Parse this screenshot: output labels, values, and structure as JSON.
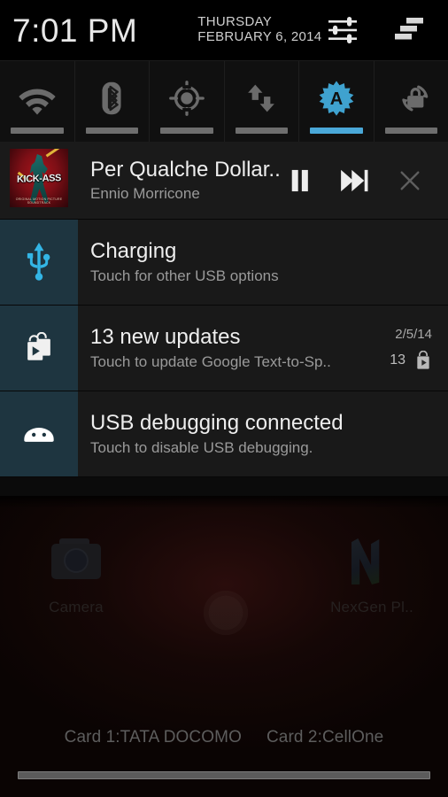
{
  "status_bar": {
    "clock": "7:01 PM",
    "weekday": "THURSDAY",
    "date": "FEBRUARY 6, 2014",
    "settings_icon": "settings-sliders-icon",
    "notification_list_icon": "notification-list-icon"
  },
  "quick_settings": {
    "toggles": [
      {
        "name": "wifi",
        "icon": "wifi-icon",
        "label": "Wi-Fi",
        "active": false
      },
      {
        "name": "bluetooth",
        "icon": "bluetooth-icon",
        "label": "Bluetooth",
        "active": false
      },
      {
        "name": "gps",
        "icon": "location-gps-icon",
        "label": "GPS",
        "active": false
      },
      {
        "name": "data-sync",
        "icon": "data-sync-arrows-icon",
        "label": "Data",
        "active": false
      },
      {
        "name": "auto-brightness",
        "icon": "auto-brightness-icon",
        "label": "Auto brightness",
        "active": true
      },
      {
        "name": "rotation-lock",
        "icon": "rotation-lock-icon",
        "label": "Rotation lock",
        "active": false
      }
    ],
    "active_color": "#4aa8d8",
    "inactive_color": "#6e6e6e"
  },
  "notifications": [
    {
      "type": "media",
      "icon": "album-art",
      "album_art": {
        "title_text": "KICK-ASS",
        "credits_text": "ORIGINAL MOTION PICTURE SOUNDTRACK"
      },
      "title": "Per Qualche Dollar..",
      "subtitle": "Ennio Morricone",
      "controls": [
        {
          "name": "pause-button",
          "icon": "pause-icon"
        },
        {
          "name": "next-track-button",
          "icon": "next-track-icon"
        },
        {
          "name": "dismiss-button",
          "icon": "close-x-icon"
        }
      ]
    },
    {
      "type": "standard",
      "icon": "usb-icon",
      "title": "Charging",
      "subtitle": "Touch for other USB options",
      "time": "",
      "count": ""
    },
    {
      "type": "standard",
      "icon": "play-store-bag-icon",
      "title": "13 new updates",
      "subtitle": "Touch to update Google Text-to-Sp..",
      "time": "2/5/14",
      "count": "13",
      "count_icon": "play-store-bag-small-icon"
    },
    {
      "type": "standard",
      "icon": "android-head-icon",
      "title": "USB debugging connected",
      "subtitle": "Touch to disable USB debugging.",
      "time": "",
      "count": ""
    }
  ],
  "home_screen": {
    "icons": [
      {
        "name": "camera",
        "label": "Camera",
        "icon": "camera-icon"
      },
      {
        "name": "nexgen-player",
        "label": "NexGen Pl..",
        "icon": "nexgen-player-icon"
      }
    ]
  },
  "sim_bar": {
    "card1": "Card 1:TATA DOCOMO",
    "card2": "Card 2:CellOne",
    "drag_handle": "shade-drag-handle"
  },
  "colors": {
    "accent_blue": "#4aa8d8",
    "icon_panel": "#1e3540",
    "notif_bg": "#191919",
    "shade_bg": "#0b0b0b"
  }
}
